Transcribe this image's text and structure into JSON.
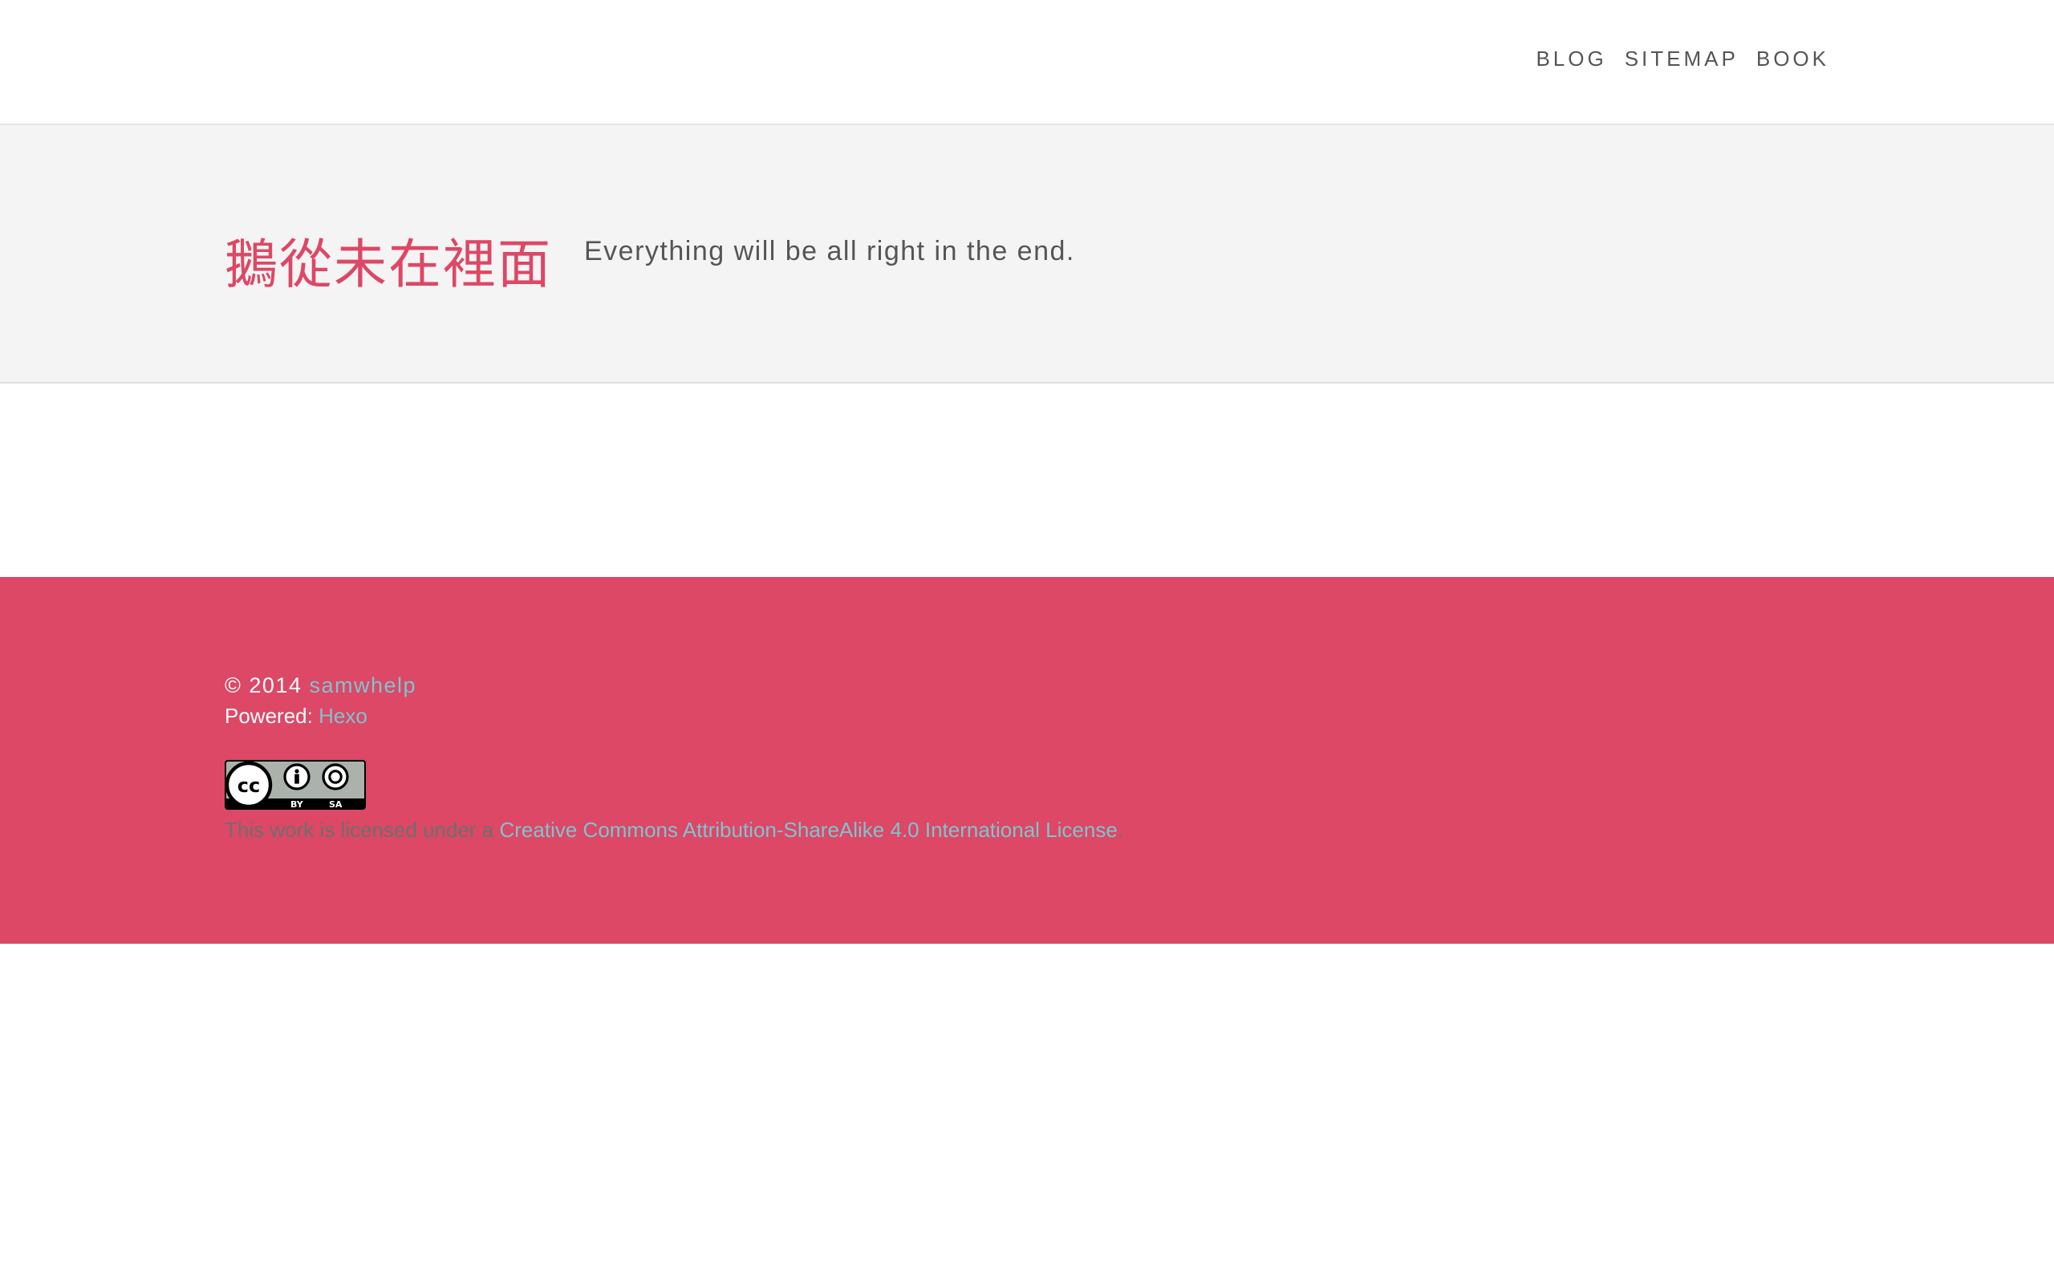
{
  "nav": {
    "items": [
      {
        "label": "BLOG"
      },
      {
        "label": "SITEMAP"
      },
      {
        "label": "BOOK"
      }
    ]
  },
  "hero": {
    "title": "鵝從未在裡面",
    "subtitle": "Everything will be all right in the end."
  },
  "footer": {
    "copyright_prefix": "© 2014",
    "author": "samwhelp",
    "powered_label": "Powered:",
    "powered_link": "Hexo",
    "badge": {
      "icon": "cc-by-sa-icon",
      "text_by": "BY",
      "text_sa": "SA"
    },
    "license_prefix": "This work is licensed under a",
    "license_link": "Creative Commons Attribution-ShareAlike 4.0 International License",
    "license_suffix": "."
  },
  "colors": {
    "accent": "#dc4865",
    "link": "#7fc3cf",
    "hero_bg": "#f4f4f4",
    "nav_text": "#555555"
  }
}
